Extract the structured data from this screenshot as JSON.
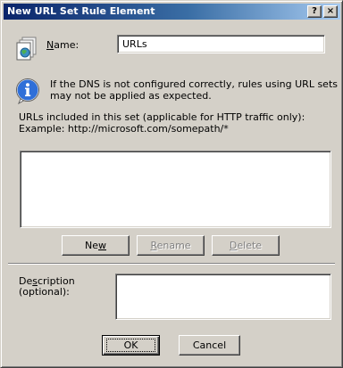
{
  "window": {
    "title": "New URL Set Rule Element",
    "help_button": "?",
    "close_button": "×"
  },
  "name_field": {
    "label_prefix": "",
    "label_accel": "N",
    "label_rest": "ame:",
    "value": "URLs"
  },
  "info": {
    "line1": "If the DNS is not configured correctly, rules using URL sets",
    "line2": "may not be applied as expected."
  },
  "urls_section": {
    "label_line1": "URLs included in this set (applicable for HTTP traffic only):",
    "label_line2": "Example: http://microsoft.com/somepath/*",
    "items": []
  },
  "list_buttons": {
    "new": {
      "pre": "Ne",
      "accel": "w",
      "post": ""
    },
    "rename": {
      "pre": "",
      "accel": "R",
      "post": "ename"
    },
    "delete": {
      "pre": "",
      "accel": "D",
      "post": "elete"
    }
  },
  "description": {
    "label_pre": "De",
    "label_accel": "s",
    "label_post": "cription",
    "label_line2": "(optional):",
    "value": ""
  },
  "dialog_buttons": {
    "ok": "OK",
    "cancel": "Cancel"
  }
}
